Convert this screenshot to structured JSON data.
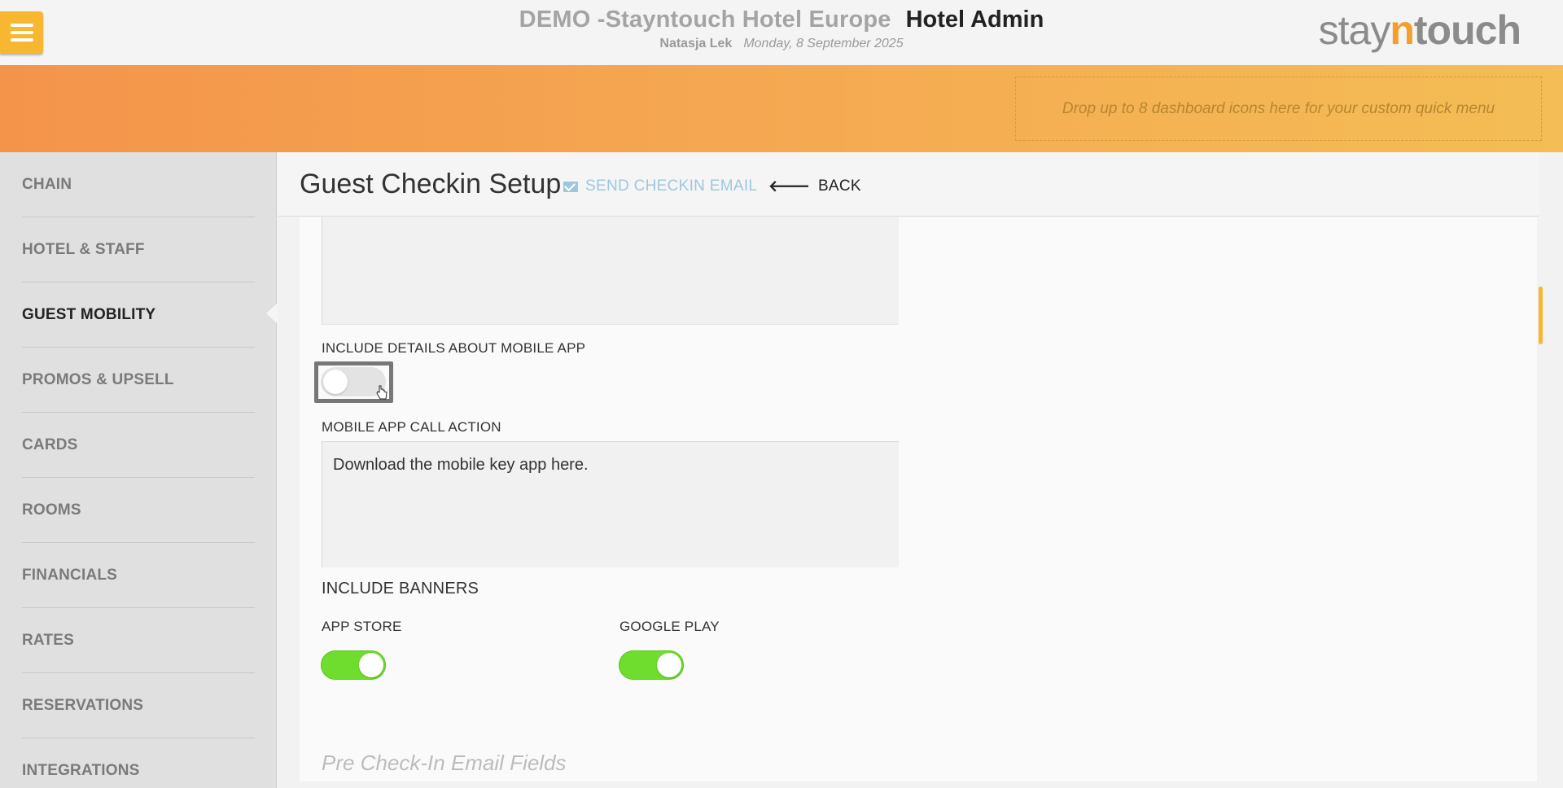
{
  "header": {
    "hotel_name": "DEMO -Stayntouch Hotel Europe",
    "app_name": "Hotel Admin",
    "user_name": "Natasja Lek",
    "date": "Monday, 8 September 2025",
    "logo": {
      "part1": "stay",
      "part2": "n",
      "part3": "touch"
    },
    "menu_icon": "hamburger-icon"
  },
  "banner": {
    "drop_zone_text": "Drop up to 8 dashboard icons here for your custom quick menu"
  },
  "sidebar": {
    "items": [
      {
        "label": "CHAIN",
        "active": false
      },
      {
        "label": "HOTEL & STAFF",
        "active": false
      },
      {
        "label": "GUEST MOBILITY",
        "active": true
      },
      {
        "label": "PROMOS & UPSELL",
        "active": false
      },
      {
        "label": "CARDS",
        "active": false
      },
      {
        "label": "ROOMS",
        "active": false
      },
      {
        "label": "FINANCIALS",
        "active": false
      },
      {
        "label": "RATES",
        "active": false
      },
      {
        "label": "RESERVATIONS",
        "active": false
      },
      {
        "label": "INTEGRATIONS",
        "active": false
      }
    ]
  },
  "page": {
    "title": "Guest Checkin Setup",
    "send_email_label": "SEND CHECKIN EMAIL",
    "back_label": "BACK",
    "back_icon": "arrow-left-icon",
    "mail_icon": "envelope-icon"
  },
  "form": {
    "include_mobile_app_label": "INCLUDE DETAILS ABOUT MOBILE APP",
    "include_mobile_app_on": false,
    "mobile_app_cta_label": "MOBILE APP CALL ACTION",
    "mobile_app_cta_value": "Download the mobile key app here.",
    "include_banners_label": "INCLUDE BANNERS",
    "app_store_label": "APP STORE",
    "app_store_on": true,
    "google_play_label": "GOOGLE PLAY",
    "google_play_on": true,
    "next_section_heading": "Pre Check-In Email Fields"
  },
  "colors": {
    "accent": "#f7b731",
    "banner_start": "#f4944b",
    "banner_end": "#f4bd55",
    "toggle_on": "#6fdd2e",
    "link": "#9fc7dc"
  }
}
